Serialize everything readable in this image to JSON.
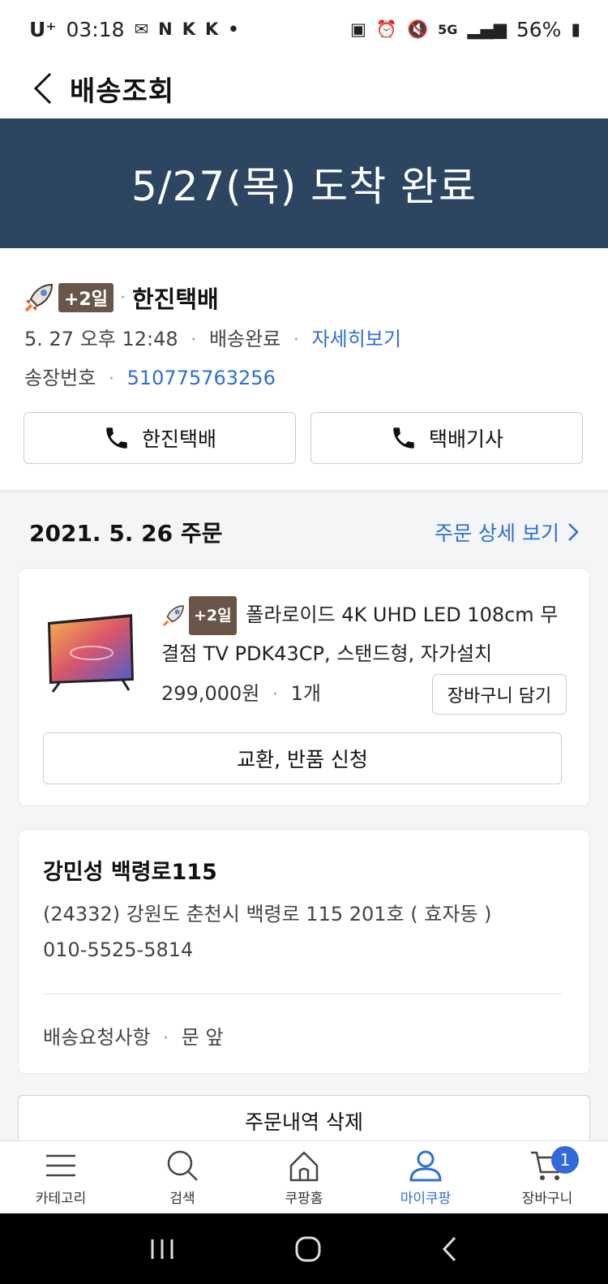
{
  "status_bar": {
    "carrier": "U⁺",
    "time": "03:18",
    "left_icons": [
      "mail-icon",
      "nfc-icon",
      "k-app-icon",
      "k-app-icon",
      "dot-icon"
    ],
    "right_icons": [
      "battery-saver-icon",
      "alarm-icon",
      "mute-icon",
      "5g-icon",
      "signal-icon"
    ],
    "battery": "56%"
  },
  "header": {
    "title": "배송조회"
  },
  "banner": {
    "text": "5/27(목) 도착 완료"
  },
  "shipping": {
    "badge": "+2일",
    "courier": "한진택배",
    "datetime": "5. 27 오후 12:48",
    "status": "배송완료",
    "detail_link": "자세히보기",
    "invoice_label": "송장번호",
    "invoice_number": "510775763256",
    "call_courier_label": "한진택배",
    "call_driver_label": "택배기사"
  },
  "order": {
    "date_label": "2021. 5. 26 주문",
    "detail_link": "주문 상세 보기"
  },
  "product": {
    "badge": "+2일",
    "title": "폴라로이드 4K UHD LED 108cm 무결점 TV PDK43CP, 스탠드형, 자가설치",
    "price": "299,000원",
    "quantity": "1개",
    "cart_button": "장바구니 담기",
    "return_button": "교환, 반품 신청"
  },
  "address": {
    "name": "강민성 백령로115",
    "line": "(24332) 강원도 춘천시 백령로 115 201호 ( 효자동 )",
    "phone": "010-5525-5814",
    "request_label": "배송요청사항",
    "request_value": "문 앞"
  },
  "delete_button": "주문내역 삭제",
  "tabbar": {
    "items": [
      {
        "label": "카테고리",
        "icon": "menu-icon"
      },
      {
        "label": "검색",
        "icon": "search-icon"
      },
      {
        "label": "쿠팡홈",
        "icon": "home-icon"
      },
      {
        "label": "마이쿠팡",
        "icon": "user-icon",
        "active": true
      },
      {
        "label": "장바구니",
        "icon": "cart-icon",
        "badge": "1"
      }
    ]
  },
  "colors": {
    "banner": "#2c4561",
    "link": "#2f6fd0",
    "badge": "#6a5648",
    "cart_badge": "#3469d9"
  }
}
